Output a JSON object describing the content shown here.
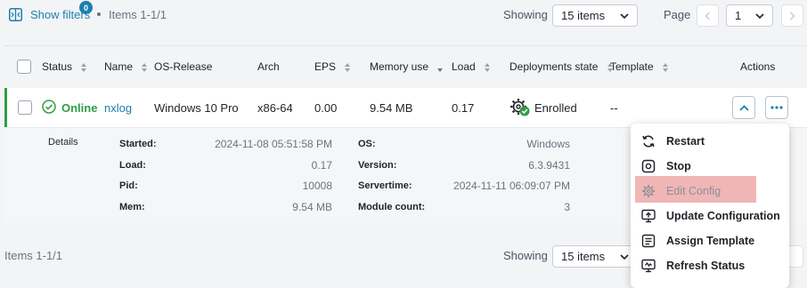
{
  "toolbar": {
    "show_filters": "Show filters",
    "filter_count": "0",
    "items_range": "Items 1-1/1",
    "showing_label": "Showing",
    "page_size": "15 items",
    "page_label": "Page",
    "page_number": "1"
  },
  "table": {
    "headers": {
      "status": "Status",
      "name": "Name",
      "os_release": "OS-Release",
      "arch": "Arch",
      "eps": "EPS",
      "memory_use": "Memory use",
      "load": "Load",
      "deployments_state": "Deployments state",
      "template": "Template",
      "actions": "Actions"
    },
    "row": {
      "status": "Online",
      "name": "nxlog",
      "os_release": "Windows 10 Pro",
      "arch": "x86-64",
      "eps": "0.00",
      "memory_use": "9.54 MB",
      "load": "0.17",
      "deployments_state": "Enrolled",
      "template": "--"
    }
  },
  "details": {
    "section_label": "Details",
    "left": [
      {
        "label": "Started:",
        "value": "2024-11-08 05:51:58 PM"
      },
      {
        "label": "Load:",
        "value": "0.17"
      },
      {
        "label": "Pid:",
        "value": "10008"
      },
      {
        "label": "Mem:",
        "value": "9.54 MB"
      }
    ],
    "right": [
      {
        "label": "OS:",
        "value": "Windows"
      },
      {
        "label": "Version:",
        "value": "6.3.9431"
      },
      {
        "label": "Servertime:",
        "value": "2024-11-11 06:09:07 PM"
      },
      {
        "label": "Module count:",
        "value": "3"
      }
    ]
  },
  "actions_menu": {
    "items": [
      {
        "label": "Restart",
        "icon": "restart-icon",
        "enabled": true
      },
      {
        "label": "Stop",
        "icon": "stop-icon",
        "enabled": true
      },
      {
        "label": "Edit Config",
        "icon": "gear-icon",
        "enabled": false
      },
      {
        "label": "Update Configuration",
        "icon": "monitor-upload-icon",
        "enabled": true
      },
      {
        "label": "Assign Template",
        "icon": "template-icon",
        "enabled": true
      },
      {
        "label": "Refresh Status",
        "icon": "monitor-refresh-icon",
        "enabled": true
      }
    ]
  },
  "footer": {
    "items_range": "Items 1-1/1",
    "showing_label": "Showing",
    "page_size": "15 items"
  },
  "colors": {
    "accent": "#1d7fae",
    "online": "#2f9e44",
    "highlight": "#f0b6b6"
  }
}
